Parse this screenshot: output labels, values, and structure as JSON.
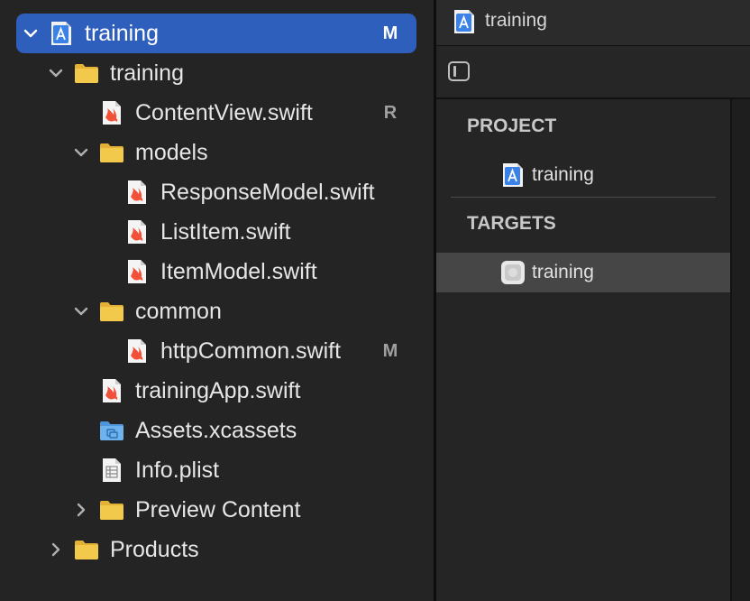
{
  "navigator": {
    "items": [
      {
        "label": "training",
        "badge": "M",
        "kind": "project",
        "depth": 0,
        "disclosure": "expanded",
        "selected": true
      },
      {
        "label": "training",
        "badge": "",
        "kind": "folder",
        "depth": 1,
        "disclosure": "expanded"
      },
      {
        "label": "ContentView.swift",
        "badge": "R",
        "kind": "swift",
        "depth": 2,
        "disclosure": "none"
      },
      {
        "label": "models",
        "badge": "",
        "kind": "folder",
        "depth": 2,
        "disclosure": "expanded"
      },
      {
        "label": "ResponseModel.swift",
        "badge": "",
        "kind": "swift",
        "depth": 3,
        "disclosure": "none"
      },
      {
        "label": "ListItem.swift",
        "badge": "",
        "kind": "swift",
        "depth": 3,
        "disclosure": "none"
      },
      {
        "label": "ItemModel.swift",
        "badge": "",
        "kind": "swift",
        "depth": 3,
        "disclosure": "none"
      },
      {
        "label": "common",
        "badge": "",
        "kind": "folder",
        "depth": 2,
        "disclosure": "expanded"
      },
      {
        "label": "httpCommon.swift",
        "badge": "M",
        "kind": "swift",
        "depth": 3,
        "disclosure": "none"
      },
      {
        "label": "trainingApp.swift",
        "badge": "",
        "kind": "swift",
        "depth": 2,
        "disclosure": "none"
      },
      {
        "label": "Assets.xcassets",
        "badge": "",
        "kind": "assets",
        "depth": 2,
        "disclosure": "none"
      },
      {
        "label": "Info.plist",
        "badge": "",
        "kind": "plist",
        "depth": 2,
        "disclosure": "none"
      },
      {
        "label": "Preview Content",
        "badge": "",
        "kind": "folder",
        "depth": 2,
        "disclosure": "collapsed"
      },
      {
        "label": "Products",
        "badge": "",
        "kind": "folder",
        "depth": 1,
        "disclosure": "collapsed"
      }
    ]
  },
  "editor": {
    "title": "training",
    "title_icon": "xcode-project-icon",
    "toolbar": {
      "toggle_icon": "sidebar-toggle-icon"
    },
    "project_list": {
      "project_header": "PROJECT",
      "project_item": "training",
      "targets_header": "TARGETS",
      "target_item": "training"
    }
  },
  "colors": {
    "selection": "#2f5fbd",
    "folder": "#f3c94b",
    "swift": "#f05138",
    "project_icon": "#3b82e8"
  }
}
